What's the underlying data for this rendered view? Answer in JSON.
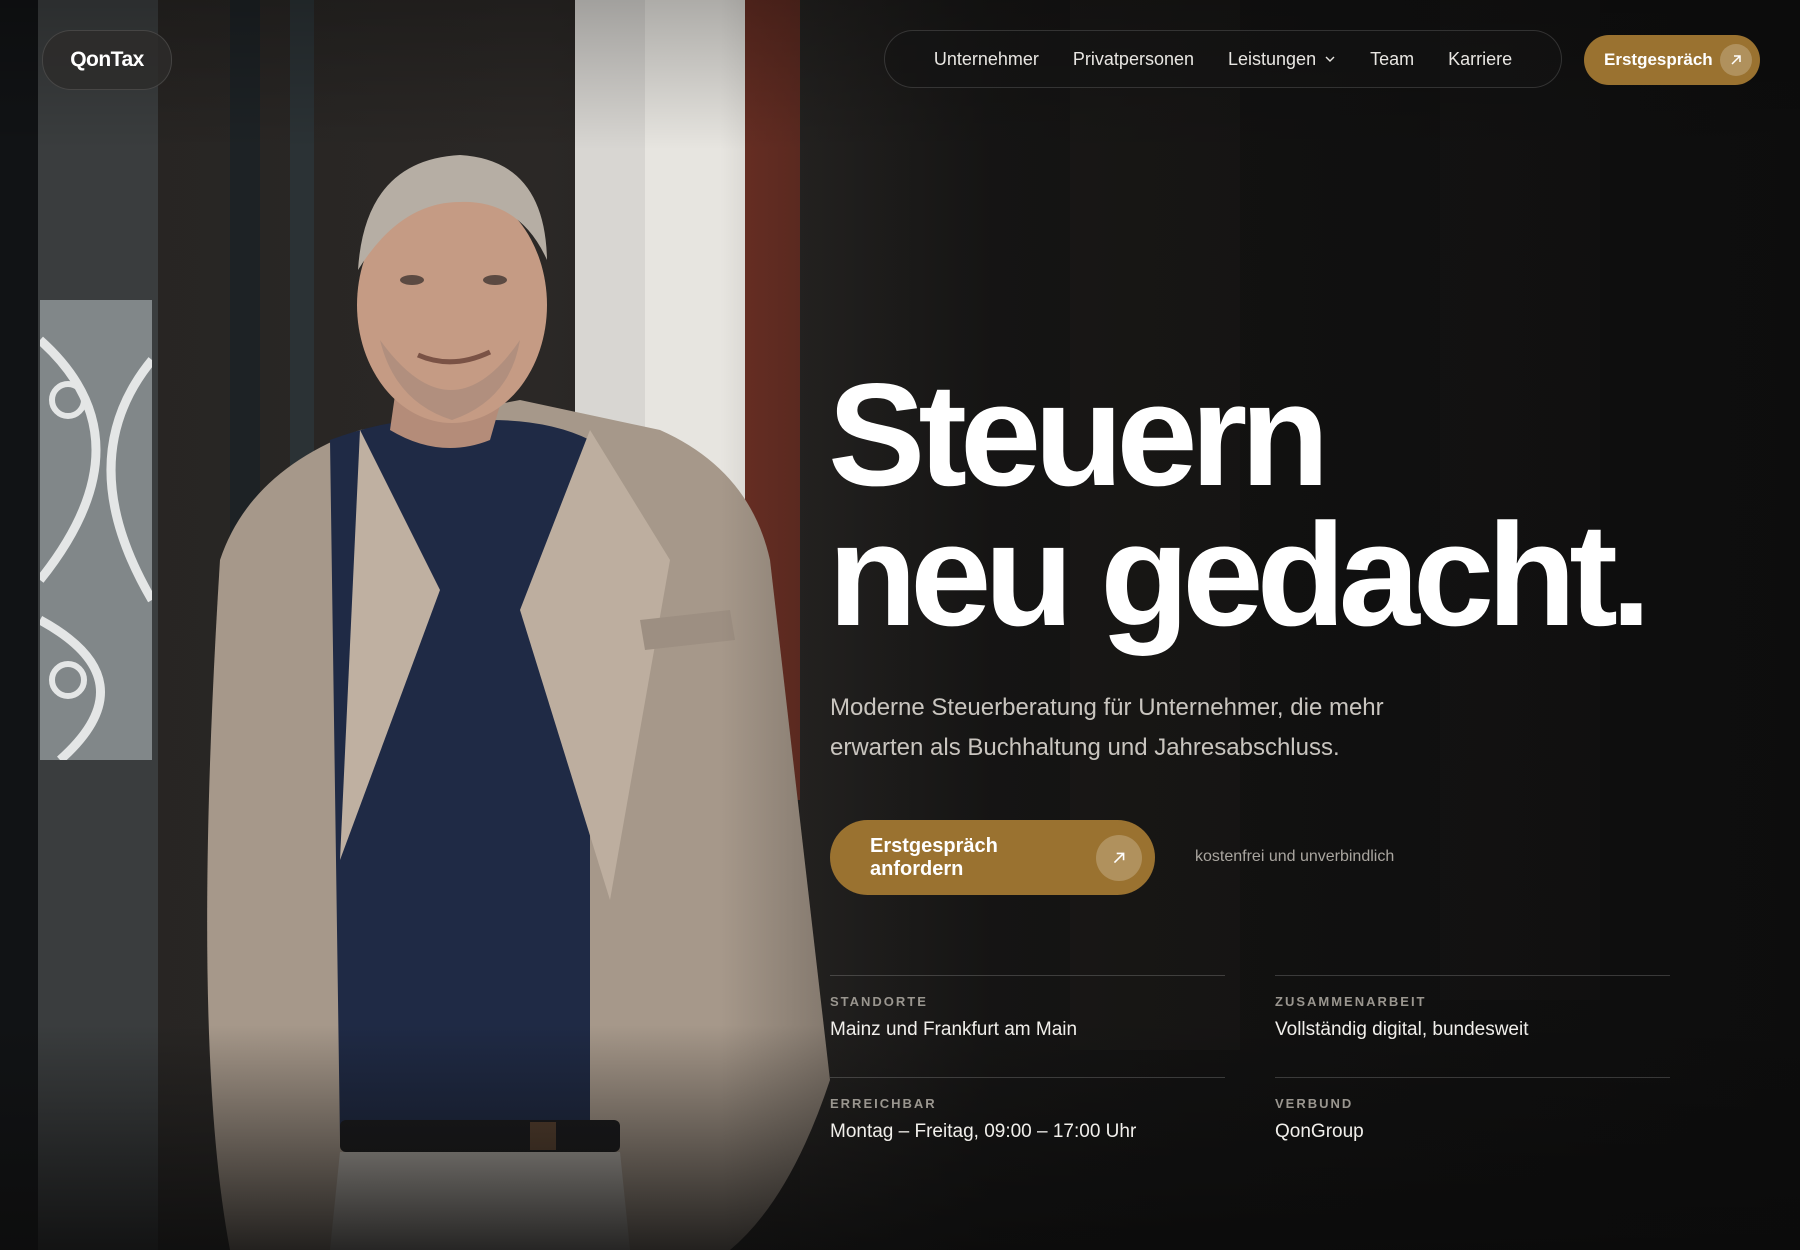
{
  "brand": {
    "logo": "QonTax"
  },
  "nav": {
    "items": [
      "Unternehmer",
      "Privatpersonen",
      "Leistungen",
      "Team",
      "Karriere"
    ],
    "dropdown_item": "Leistungen",
    "cta": "Erstgespräch"
  },
  "hero": {
    "headline_line1": "Steuern",
    "headline_line2": "neu gedacht.",
    "subline": "Moderne Steuerberatung für Unternehmer, die mehr erwarten als Buchhaltung und Jahresabschluss.",
    "cta": "Erstgespräch anfordern",
    "cta_note": "kostenfrei und unverbindlich"
  },
  "info": [
    {
      "label": "STANDORTE",
      "value": "Mainz und Frankfurt am Main"
    },
    {
      "label": "ZUSAMMENARBEIT",
      "value": "Vollständig digital, bundesweit"
    },
    {
      "label": "ERREICHBAR",
      "value": "Montag – Freitag, 09:00 – 17:00 Uhr"
    },
    {
      "label": "VERBUND",
      "value": "QonGroup"
    }
  ],
  "colors": {
    "accent": "#9a7230",
    "background": "#1a1816",
    "text": "#ffffff",
    "muted": "#c9c5bf"
  },
  "icons": {
    "nav_dropdown": "chevron-down-icon",
    "cta": "arrow-up-right-icon"
  }
}
